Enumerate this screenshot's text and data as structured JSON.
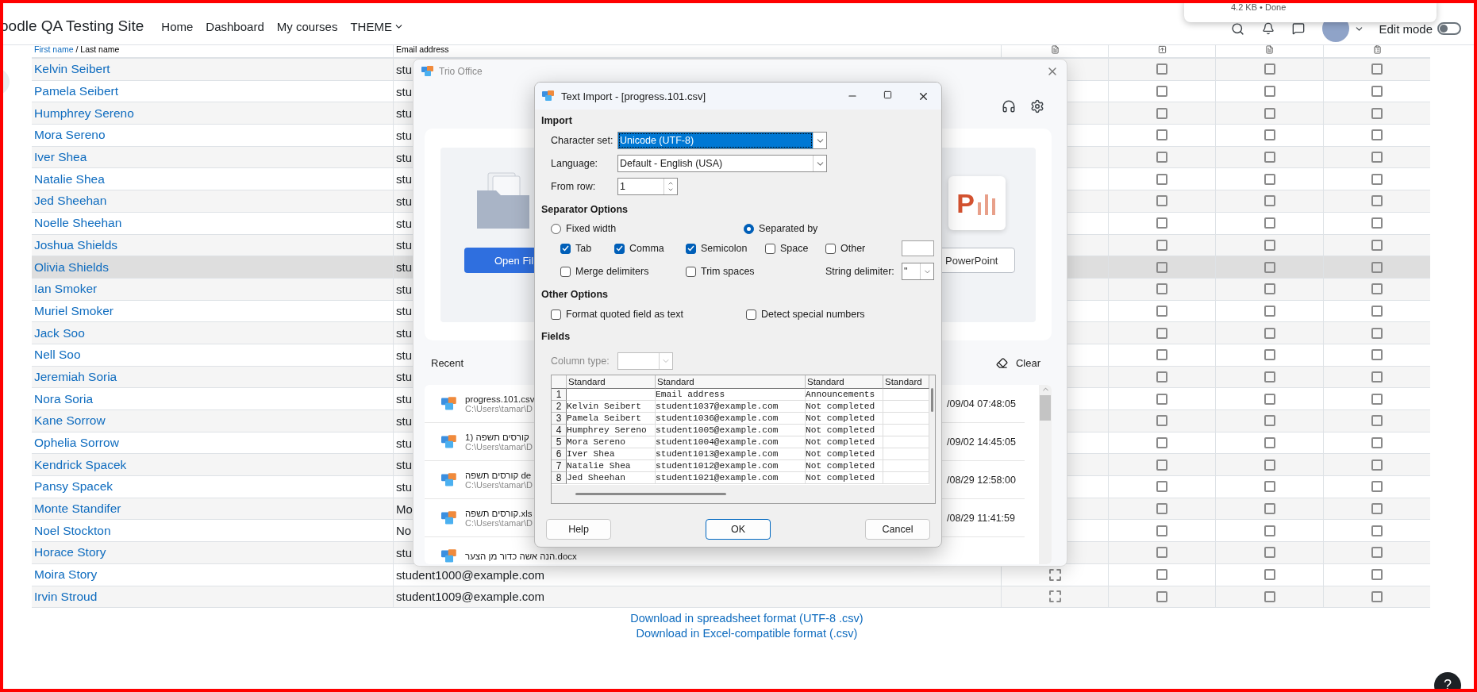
{
  "header": {
    "site_name": "oodle QA Testing Site",
    "nav": [
      {
        "label": "Home",
        "dropdown": false
      },
      {
        "label": "Dashboard",
        "dropdown": false
      },
      {
        "label": "My courses",
        "dropdown": false
      },
      {
        "label": "THEME",
        "dropdown": true
      }
    ],
    "edit_mode": {
      "label": "Edit mode",
      "on": false
    }
  },
  "download_popup": {
    "status": "4.2 KB • Done"
  },
  "table": {
    "columns": [
      {
        "kind": "name",
        "label": "First name",
        "rest": "/ Last name"
      },
      {
        "kind": "email",
        "label": "Email address"
      },
      {
        "kind": "icon"
      },
      {
        "kind": "icon"
      },
      {
        "kind": "icon"
      },
      {
        "kind": "icon"
      }
    ],
    "rows": [
      {
        "name": "Kelvin Seibert",
        "email": "stu",
        "highlighted": false,
        "checks": [
          false,
          false,
          false
        ]
      },
      {
        "name": "Pamela Seibert",
        "email": "stu",
        "highlighted": false,
        "checks": [
          false,
          false,
          false
        ]
      },
      {
        "name": "Humphrey Sereno",
        "email": "stu",
        "highlighted": false,
        "checks": [
          false,
          false,
          false
        ]
      },
      {
        "name": "Mora Sereno",
        "email": "stu",
        "highlighted": false,
        "checks": [
          false,
          false,
          false
        ]
      },
      {
        "name": "Iver Shea",
        "email": "stu",
        "highlighted": false,
        "checks": [
          false,
          false,
          false
        ]
      },
      {
        "name": "Natalie Shea",
        "email": "stu",
        "highlighted": false,
        "checks": [
          false,
          false,
          false
        ]
      },
      {
        "name": "Jed Sheehan",
        "email": "stu",
        "highlighted": false,
        "checks": [
          false,
          false,
          false
        ]
      },
      {
        "name": "Noelle Sheehan",
        "email": "stu",
        "highlighted": false,
        "checks": [
          false,
          false,
          false
        ]
      },
      {
        "name": "Joshua Shields",
        "email": "stu",
        "highlighted": false,
        "checks": [
          false,
          false,
          false
        ]
      },
      {
        "name": "Olivia Shields",
        "email": "stu",
        "highlighted": true,
        "checks": [
          false,
          false,
          false
        ]
      },
      {
        "name": "Ian Smoker",
        "email": "stu",
        "highlighted": false,
        "checks": [
          false,
          false,
          false
        ]
      },
      {
        "name": "Muriel Smoker",
        "email": "stu",
        "highlighted": false,
        "checks": [
          false,
          false,
          false
        ]
      },
      {
        "name": "Jack Soo",
        "email": "stu",
        "highlighted": false,
        "checks": [
          false,
          false,
          false
        ]
      },
      {
        "name": "Nell Soo",
        "email": "stu",
        "highlighted": false,
        "checks": [
          false,
          false,
          false
        ]
      },
      {
        "name": "Jeremiah Soria",
        "email": "stu",
        "highlighted": false,
        "checks": [
          false,
          false,
          false
        ]
      },
      {
        "name": "Nora Soria",
        "email": "stu",
        "highlighted": false,
        "checks": [
          false,
          false,
          false
        ]
      },
      {
        "name": "Kane Sorrow",
        "email": "stu",
        "highlighted": false,
        "checks": [
          false,
          false,
          false
        ]
      },
      {
        "name": "Ophelia Sorrow",
        "email": "stu",
        "highlighted": false,
        "checks": [
          false,
          false,
          false
        ]
      },
      {
        "name": "Kendrick Spacek",
        "email": "stu",
        "highlighted": false,
        "checks": [
          false,
          false,
          false
        ]
      },
      {
        "name": "Pansy Spacek",
        "email": "stu",
        "highlighted": false,
        "checks": [
          false,
          false,
          false
        ]
      },
      {
        "name": "Monte Standifer",
        "email": "Mo",
        "highlighted": false,
        "checks": [
          false,
          false,
          false
        ]
      },
      {
        "name": "Noel Stockton",
        "email": "No",
        "highlighted": false,
        "checks": [
          false,
          false,
          false
        ]
      },
      {
        "name": "Horace Story",
        "email": "stu",
        "highlighted": false,
        "checks": [
          false,
          false,
          false
        ]
      },
      {
        "name": "Moira Story",
        "email": "student1000@example.com",
        "highlighted": false,
        "column_3": {
          "kind": "dashed_box",
          "checked": false
        },
        "checks": [
          false,
          false,
          false
        ]
      },
      {
        "name": "Irvin Stroud",
        "email": "student1009@example.com",
        "highlighted": false,
        "column_3": {
          "kind": "dashed_box",
          "checked": false
        },
        "checks": [
          false,
          false,
          false
        ]
      }
    ]
  },
  "downloads": [
    "Download in spreadsheet format (UTF-8 .csv)",
    "Download in Excel-compatible format (.csv)"
  ],
  "help_button": "?",
  "trio": {
    "title": "Trio Office",
    "open_button": "Open Fil",
    "powerpoint_letter": "P",
    "powerpoint_button": "PowerPoint",
    "recent_label": "Recent",
    "clear_label": "Clear",
    "recent": [
      {
        "name": "progress.101.csv",
        "path": "C:\\Users\\tamar\\D",
        "time": "/09/04 07:48:05"
      },
      {
        "name": "קורסים תשפה (1",
        "path": "C:\\Users\\tamar\\D",
        "time": "/09/02 14:45:05"
      },
      {
        "name": "קורסים תשפה de",
        "path": "C:\\Users\\tamar\\D",
        "time": "/08/29 12:58:00"
      },
      {
        "name": "קורסים תשפה.xls",
        "path": "C:\\Users\\tamar\\D",
        "time": "/08/29 11:41:59"
      },
      {
        "name": "הנה אשה כדור מן הצער.docx"
      }
    ]
  },
  "dialog": {
    "title": "Text Import - [progress.101.csv]",
    "import_heading": "Import",
    "fields": [
      {
        "kind": "select",
        "label": "Character set:",
        "value": "Unicode (UTF-8)",
        "focused": true
      },
      {
        "kind": "select",
        "label": "Language:",
        "value": "Default - English (USA)",
        "focused": false
      },
      {
        "kind": "spin",
        "label": "From row:",
        "value": "1",
        "focused": false
      }
    ],
    "separator_heading": "Separator Options",
    "modes": [
      {
        "label": "Fixed width",
        "selected": false
      },
      {
        "label": "Separated by",
        "selected": true
      }
    ],
    "separators": [
      {
        "label": "Tab",
        "checked": true
      },
      {
        "label": "Comma",
        "checked": true
      },
      {
        "label": "Semicolon",
        "checked": true
      },
      {
        "label": "Space",
        "checked": false
      },
      {
        "label": "Other",
        "checked": false
      }
    ],
    "merge": {
      "label": "Merge delimiters",
      "checked": false
    },
    "trim": {
      "label": "Trim spaces",
      "checked": false
    },
    "string_delimiter": {
      "label": "String delimiter:",
      "value": "\""
    },
    "other_heading": "Other Options",
    "other_options": [
      {
        "label": "Format quoted field as text",
        "checked": false
      },
      {
        "label": "Detect special numbers",
        "checked": false
      }
    ],
    "fields_heading": "Fields",
    "column_type": {
      "label": "Column type:",
      "disabled": true
    },
    "preview": {
      "columns": [
        "Standard",
        "Standard",
        "Standard",
        "Standard"
      ],
      "rows": [
        {
          "number": "1",
          "cells": [
            null,
            "Email address",
            "Announcements",
            null
          ]
        },
        {
          "number": "2",
          "cells": [
            "Kelvin Seibert",
            "student1037@example.com",
            "Not completed",
            null
          ]
        },
        {
          "number": "3",
          "cells": [
            "Pamela Seibert",
            "student1036@example.com",
            "Not completed",
            null
          ]
        },
        {
          "number": "4",
          "cells": [
            "Humphrey Sereno",
            "student1005@example.com",
            "Not completed",
            null
          ]
        },
        {
          "number": "5",
          "cells": [
            "Mora Sereno",
            "student1004@example.com",
            "Not completed",
            null
          ]
        },
        {
          "number": "6",
          "cells": [
            "Iver Shea",
            "student1013@example.com",
            "Not completed",
            null
          ]
        },
        {
          "number": "7",
          "cells": [
            "Natalie Shea",
            "student1012@example.com",
            "Not completed",
            null
          ]
        },
        {
          "number": "8",
          "cells": [
            "Jed Sheehan",
            "student1021@example.com",
            "Not completed",
            null
          ]
        }
      ]
    },
    "buttons": [
      {
        "label": "Help",
        "default": false
      },
      {
        "label": "OK",
        "default": true
      },
      {
        "label": "Cancel",
        "default": false
      }
    ]
  }
}
